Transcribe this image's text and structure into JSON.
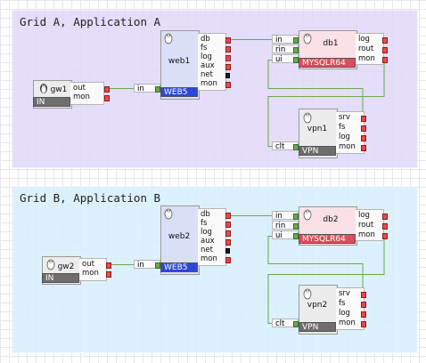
{
  "grids": {
    "a": {
      "title": "Grid A, Application A",
      "gw": {
        "name": "gw1",
        "ports": [
          "out",
          "mon"
        ],
        "tag": "IN"
      },
      "web": {
        "name": "web1",
        "input": "in",
        "ports": [
          "db",
          "fs",
          "log",
          "aux",
          "net",
          "mon"
        ],
        "tag": "WEB5"
      },
      "db": {
        "name": "db1",
        "inputs": [
          "in",
          "rin",
          "ui"
        ],
        "ports": [
          "log",
          "rout",
          "mon"
        ],
        "tag": "MYSQLR64"
      },
      "vpn": {
        "name": "vpn1",
        "input": "clt",
        "ports": [
          "srv",
          "fs",
          "log",
          "mon"
        ],
        "tag": "VPN"
      }
    },
    "b": {
      "title": "Grid B, Application B",
      "gw": {
        "name": "gw2",
        "ports": [
          "out",
          "mon"
        ],
        "tag": "IN"
      },
      "web": {
        "name": "web2",
        "input": "in",
        "ports": [
          "db",
          "fs",
          "log",
          "aux",
          "net",
          "mon"
        ],
        "tag": "WEB5"
      },
      "db": {
        "name": "db2",
        "inputs": [
          "in",
          "rin",
          "ui"
        ],
        "ports": [
          "log",
          "rout",
          "mon"
        ],
        "tag": "MYSQLR64"
      },
      "vpn": {
        "name": "vpn2",
        "input": "clt",
        "ports": [
          "srv",
          "fs",
          "log",
          "mon"
        ],
        "tag": "VPN"
      }
    }
  },
  "colors": {
    "wire": "#6aa84f",
    "port_pin": "#e84a4a",
    "web_tag": "#2b47d9",
    "db_tag": "#e04a5c",
    "io_tag": "#6e6e6e"
  },
  "icons": {
    "node": "tux-penguin-icon"
  }
}
